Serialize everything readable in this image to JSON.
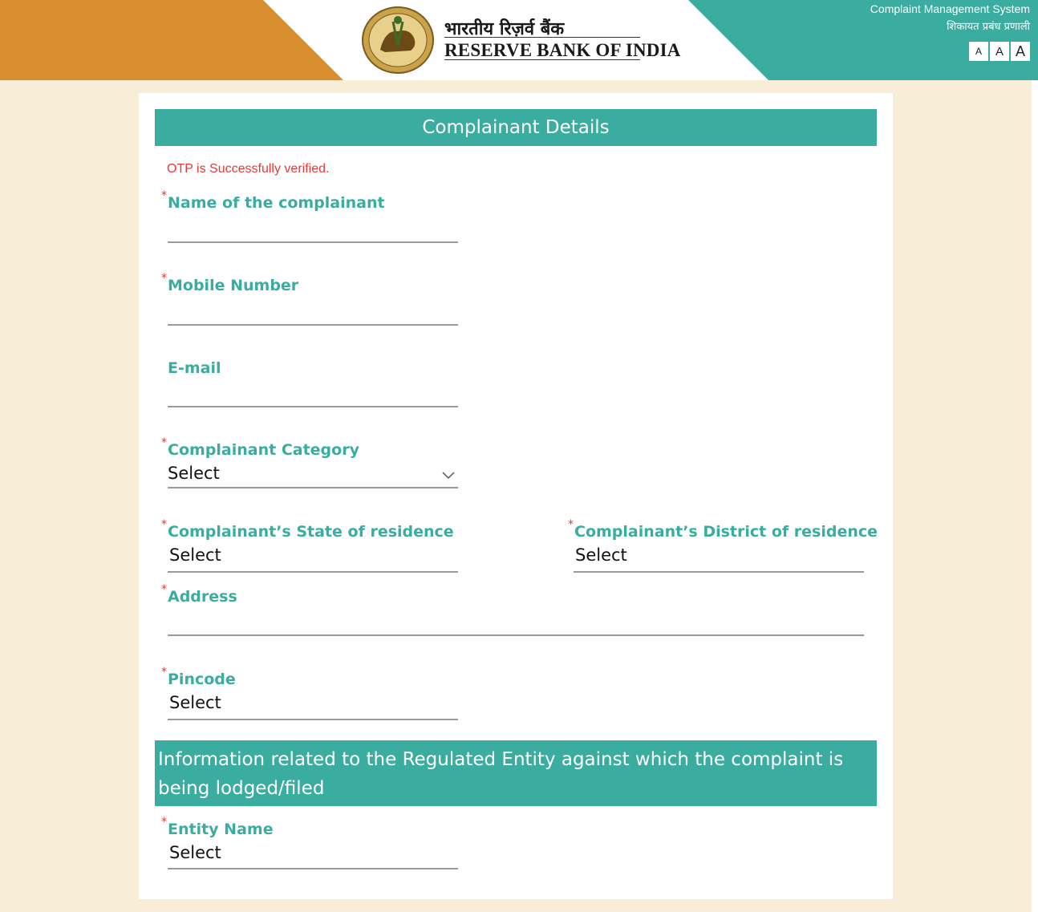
{
  "header": {
    "brand_hindi": "भारतीय रिज़र्व बैंक",
    "brand_english": "RESERVE BANK OF INDIA",
    "system_en": "Complaint Management System",
    "system_hi": "शिकायत प्रबंध प्रणाली",
    "font_size_buttons": [
      "A",
      "A",
      "A"
    ],
    "logo_icon": "rbi-emblem-icon"
  },
  "colors": {
    "orange": "#d98f30",
    "teal": "#3aada0",
    "error": "#e53935",
    "page_bg": "#f8eed8"
  },
  "form": {
    "section_title": "Complainant Details",
    "otp_message": "OTP is Successfully verified.",
    "name_label": "Name of the complainant",
    "mobile_label": "Mobile Number",
    "email_label": "E-mail",
    "category_label": "Complainant Category",
    "category_value": "Select",
    "state_label": "Complainant’s State of residence",
    "state_value": "Select",
    "district_label": "Complainant’s District of residence",
    "district_value": "Select",
    "address_label": "Address",
    "pincode_label": "Pincode",
    "pincode_value": "Select",
    "entity_section_title": "Information related to the Regulated Entity against which the complaint is being lodged/filed",
    "entity_label": "Entity Name",
    "entity_value": "Select",
    "required_marker": "*"
  }
}
